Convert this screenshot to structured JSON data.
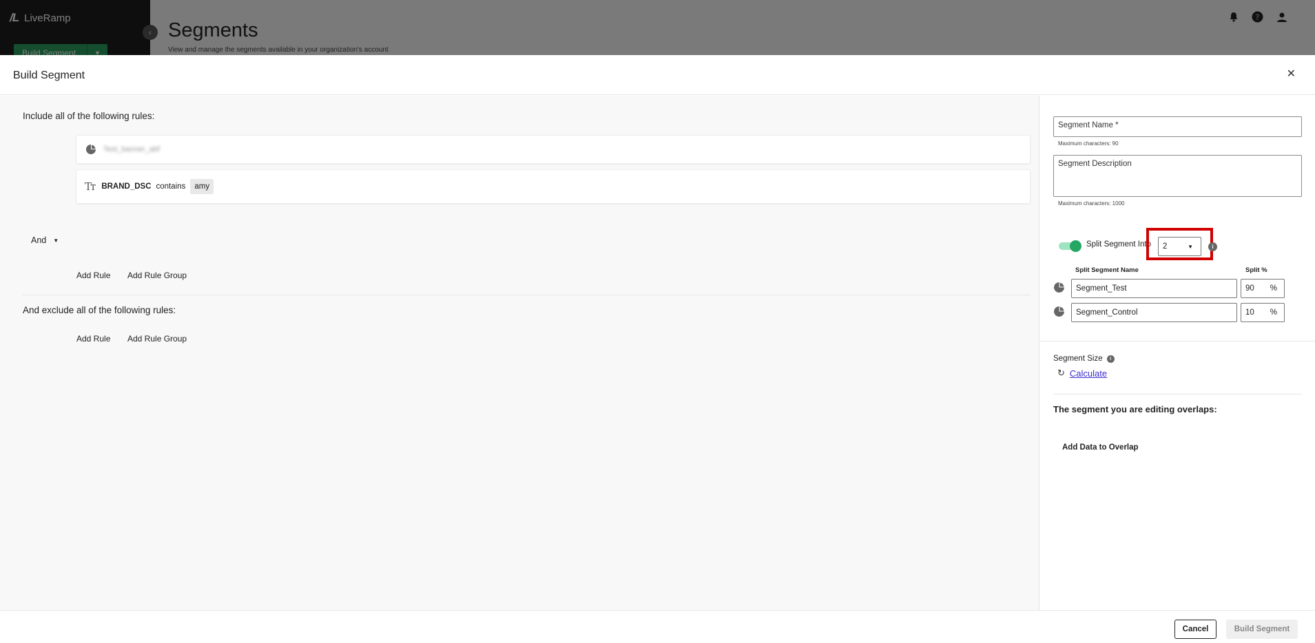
{
  "background": {
    "brand": "LiveRamp",
    "brand_mark": "/L",
    "build_button": "Build Segment",
    "page_title": "Segments",
    "page_subtitle": "View and manage the segments available in your organization's account"
  },
  "modal": {
    "title": "Build Segment",
    "include_label": "Include all of the following rules:",
    "exclude_label": "And exclude all of the following rules:",
    "and_operator": "And",
    "rules": [
      {
        "type": "segment",
        "label": "Test_banner_abf"
      },
      {
        "type": "text",
        "field": "BRAND_DSC",
        "operator": "contains",
        "value": "amy"
      }
    ],
    "add_rule": "Add Rule",
    "add_rule_group": "Add Rule Group",
    "segment_name": {
      "placeholder": "Segment Name *",
      "helper": "Maximum characters: 90"
    },
    "segment_description": {
      "placeholder": "Segment Description",
      "helper": "Maximum characters: 1000"
    },
    "split": {
      "enabled": true,
      "label": "Split Segment Into",
      "count": "2",
      "name_header": "Split Segment Name",
      "pct_header": "Split %",
      "rows": [
        {
          "name": "Segment_Test",
          "pct": "90",
          "unit": "%"
        },
        {
          "name": "Segment_Control",
          "pct": "10",
          "unit": "%"
        }
      ]
    },
    "segment_size_label": "Segment Size",
    "calculate": "Calculate",
    "overlap_title": "The segment you are editing overlaps:",
    "add_data_overlap": "Add Data to Overlap",
    "cancel": "Cancel",
    "build": "Build Segment"
  },
  "colors": {
    "accent_green": "#25a764",
    "highlight_red": "#d00000",
    "link_purple": "#3b2dcf"
  }
}
